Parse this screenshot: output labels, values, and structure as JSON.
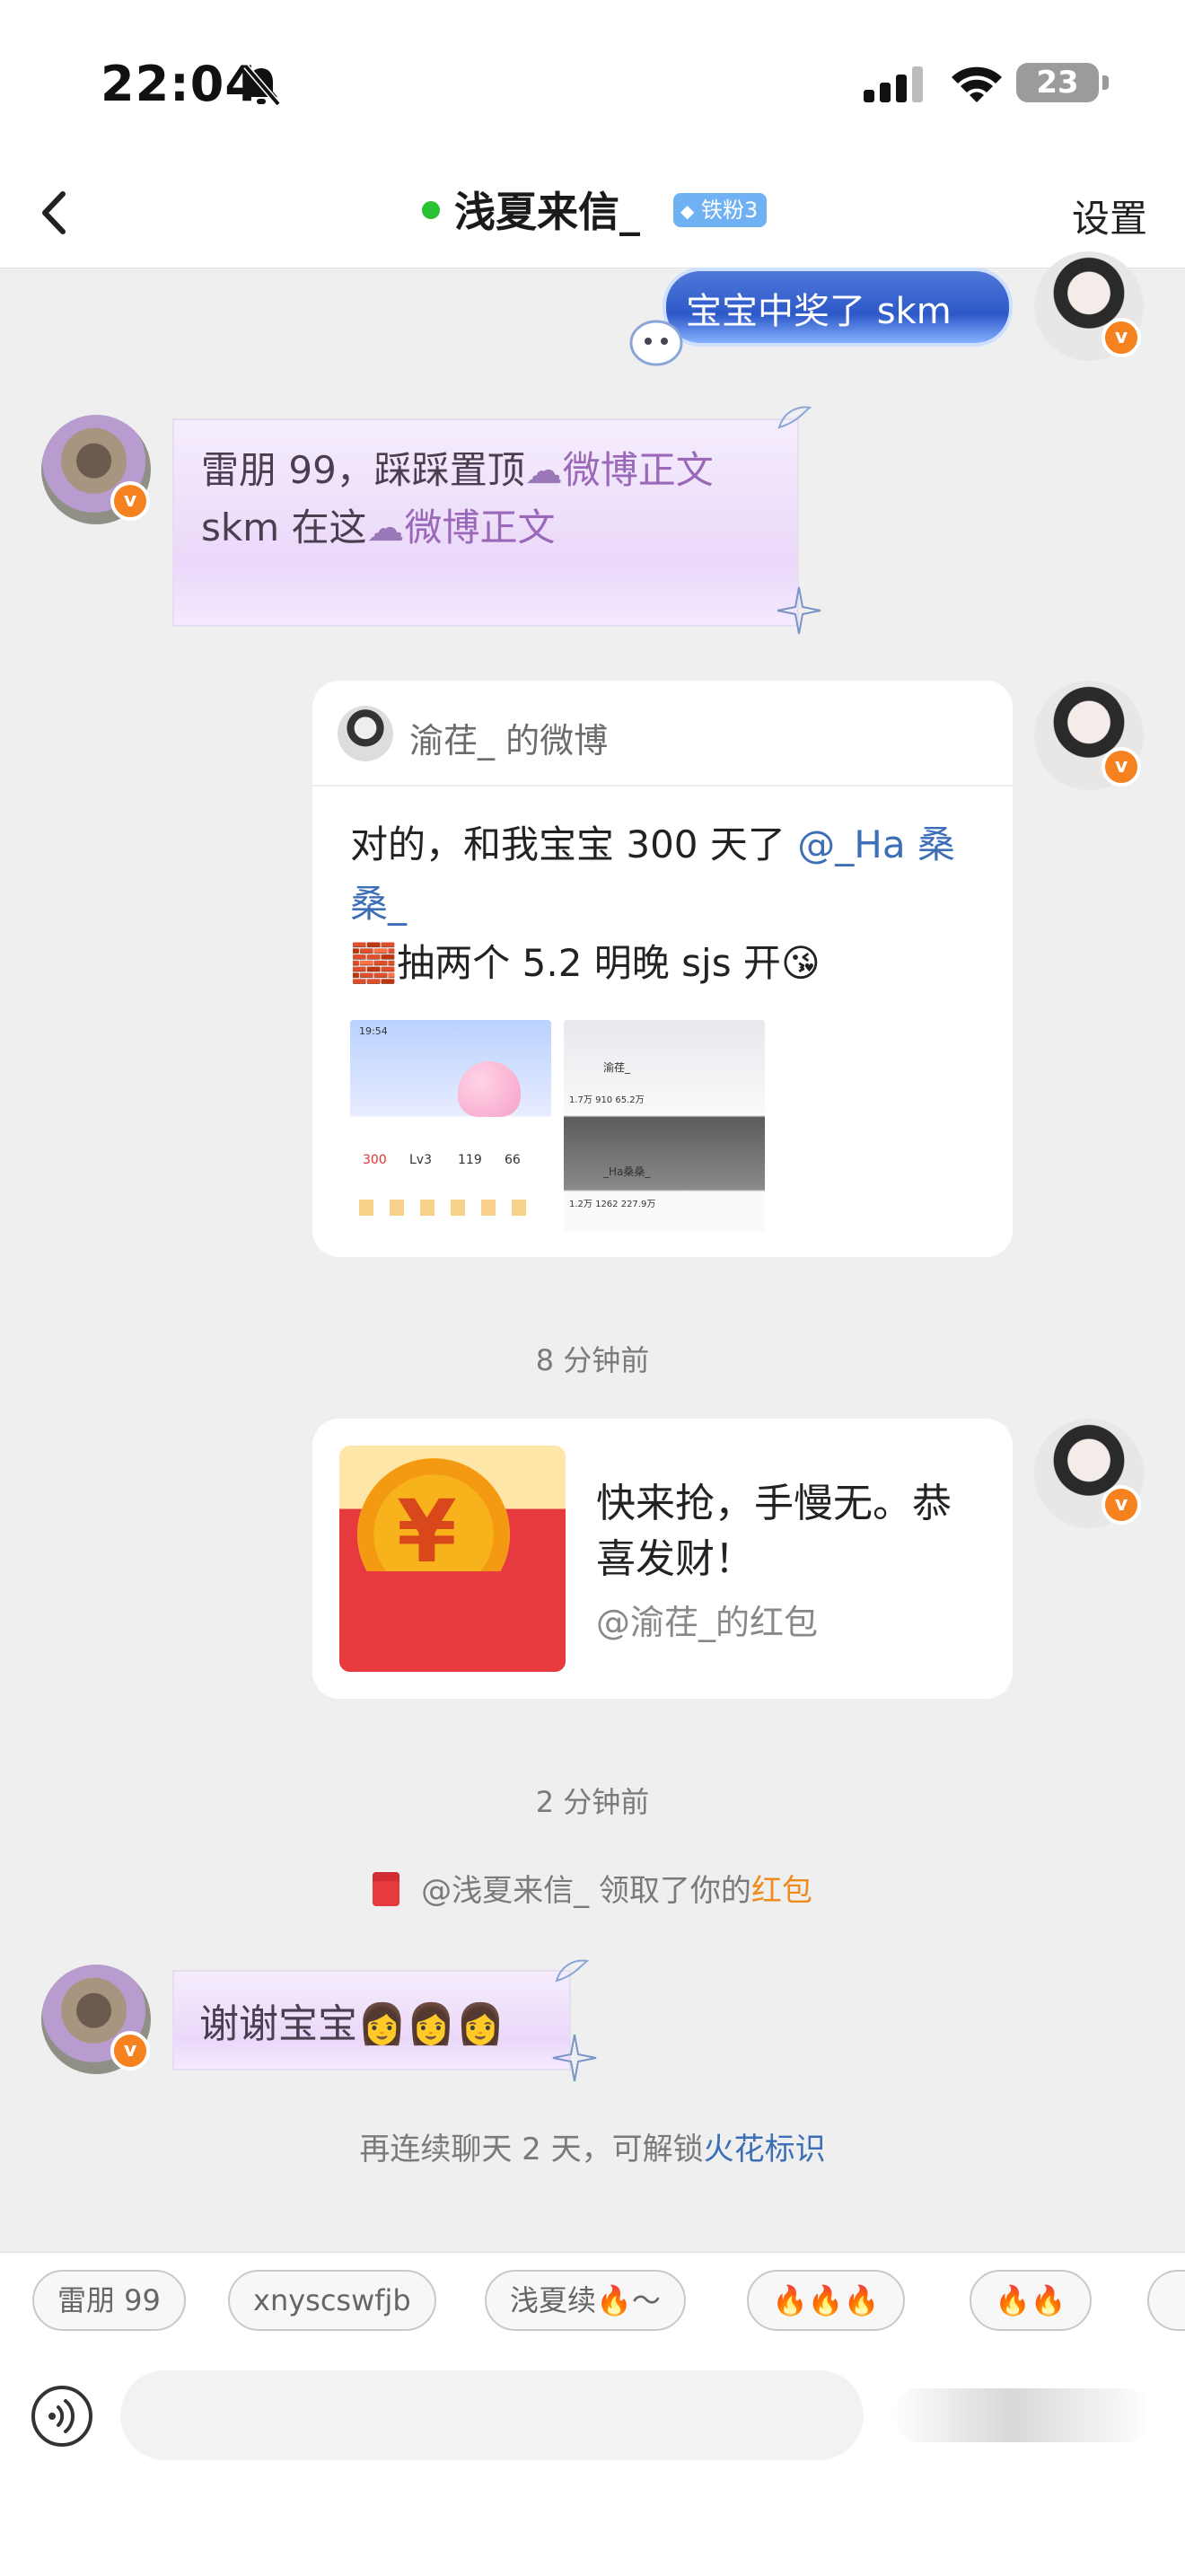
{
  "status_bar": {
    "time": "22:04",
    "battery": "23"
  },
  "header": {
    "back_icon": "chevron-left-icon",
    "name": "浅夏来信_",
    "badge": "铁粉3",
    "settings_label": "设置",
    "online_color": "#29c235"
  },
  "messages": {
    "sent_1": "宝宝中奖了 skm",
    "received_1_line1_text": "雷朋 99，踩踩置顶",
    "received_1_line1_link": "微博正文",
    "received_1_line2_text": "skm 在这",
    "received_1_line2_link": "微博正文",
    "weibo_card": {
      "author": "渝荏_ 的微博",
      "text_line1": "对的，和我宝宝 300 天了",
      "mention": "@_Ha 桑桑_",
      "text_line2": "抽两个 5.2 明晚 sjs 开",
      "thumb1_time": "19:54",
      "thumb1_number": "300",
      "thumb1_level": "Lv3",
      "thumb1_stat1": "119",
      "thumb1_stat2": "66",
      "thumb2_name1": "渝荏_",
      "thumb2_name2": "_Ha桑桑_",
      "thumb2_stats1": "1.7万  910  65.2万",
      "thumb2_stats2": "1.2万  1262  227.9万"
    },
    "time_1": "8 分钟前",
    "red_packet": {
      "title": "快来抢，手慢无。恭喜发财！",
      "sender": "@渝荏_的红包",
      "symbol": "¥"
    },
    "time_2": "2 分钟前",
    "notice_text": "@浅夏来信_ 领取了你的",
    "notice_link": "红包",
    "received_2": "谢谢宝宝",
    "spark_text": "再连续聊天 2 天，可解锁",
    "spark_link": "火花标识"
  },
  "quick_replies": [
    "雷朋 99",
    "xnyscswfjb",
    "浅夏续🔥～",
    "🔥🔥🔥",
    "🔥🔥"
  ],
  "input": {
    "voice_icon": "voice-icon",
    "placeholder": ""
  },
  "colors": {
    "accent_link": "#3d6fb8",
    "orange_link": "#f08a1c",
    "weibo_orange": "#f6821f"
  }
}
